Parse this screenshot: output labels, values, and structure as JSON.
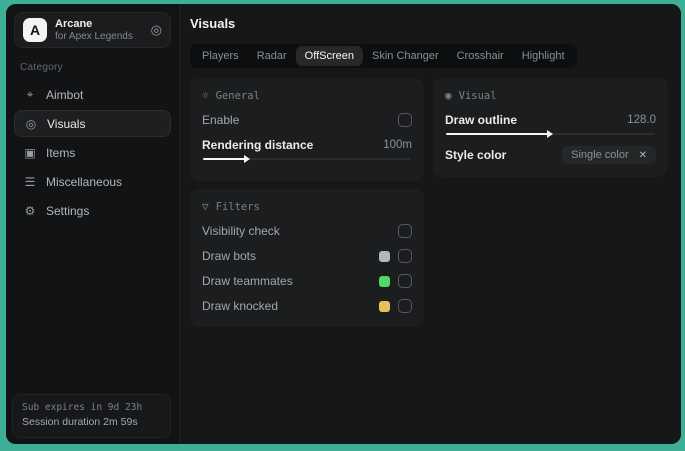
{
  "accent_bg": "#3fae97",
  "sidebar": {
    "app": {
      "initial": "A",
      "name": "Arcane",
      "subtitle": "for Apex Legends",
      "action_icon": "◎"
    },
    "category_label": "Category",
    "items": [
      {
        "label": "Aimbot",
        "icon_name": "crosshair-icon",
        "glyph": "⌖",
        "selected": false
      },
      {
        "label": "Visuals",
        "icon_name": "eye-scan-icon",
        "glyph": "◎",
        "selected": true
      },
      {
        "label": "Items",
        "icon_name": "cube-icon",
        "glyph": "▣",
        "selected": false
      },
      {
        "label": "Miscellaneous",
        "icon_name": "list-icon",
        "glyph": "☰",
        "selected": false
      },
      {
        "label": "Settings",
        "icon_name": "gear-icon",
        "glyph": "⚙",
        "selected": false
      }
    ],
    "footer": {
      "line1": "Sub expires in 9d 23h",
      "line2": "Session duration 2m 59s"
    }
  },
  "main": {
    "title": "Visuals",
    "tabs": [
      {
        "label": "Players"
      },
      {
        "label": "Radar"
      },
      {
        "label": "OffScreen",
        "selected": true
      },
      {
        "label": "Skin Changer"
      },
      {
        "label": "Crosshair"
      },
      {
        "label": "Highlight"
      }
    ],
    "general": {
      "icon": "☼",
      "title": "General",
      "enable_label": "Enable",
      "enable_checked": false,
      "distance_label": "Rendering distance",
      "distance_value": "100m",
      "slider_percent": 20
    },
    "filters": {
      "icon": "▽",
      "title": "Filters",
      "rows": [
        {
          "label": "Visibility check",
          "swatch": "",
          "checked": false
        },
        {
          "label": "Draw bots",
          "swatch": "#b4b7ba",
          "checked": false
        },
        {
          "label": "Draw teammates",
          "swatch": "#4cd964",
          "checked": false
        },
        {
          "label": "Draw knocked",
          "swatch": "#e2c35a",
          "checked": false
        }
      ]
    },
    "visual": {
      "icon": "◉",
      "title": "Visual",
      "outline_label": "Draw outline",
      "outline_value": "128.0",
      "slider_percent": 49,
      "style_label": "Style color",
      "style_chip_value": "Single color",
      "chip_close_icon": "✕"
    }
  }
}
